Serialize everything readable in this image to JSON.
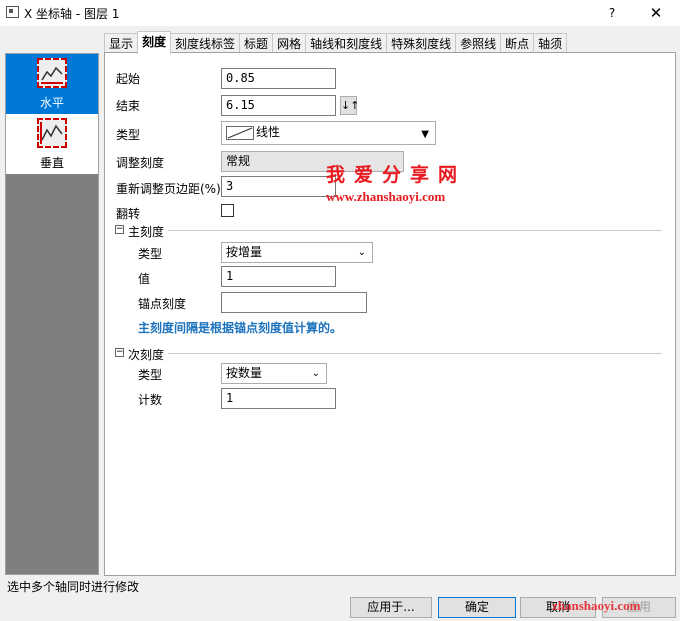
{
  "window": {
    "title": "X 坐标轴 - 图层 1",
    "help": "?",
    "close": "✕"
  },
  "tabs": [
    "显示",
    "刻度",
    "刻度线标签",
    "标题",
    "网格",
    "轴线和刻度线",
    "特殊刻度线",
    "参照线",
    "断点",
    "轴须"
  ],
  "active_tab": "刻度",
  "sidebar": {
    "items": [
      {
        "label": "水平",
        "selected": true
      },
      {
        "label": "垂直",
        "selected": false
      }
    ]
  },
  "form": {
    "start_label": "起始",
    "start_value": "0.85",
    "end_label": "结束",
    "end_value": "6.15",
    "swap_icon": "↓↑",
    "type_label": "类型",
    "type_value": "线性",
    "rescale_label": "调整刻度",
    "rescale_value": "常规",
    "margin_label": "重新调整页边距(%)",
    "margin_value": "3",
    "flip_label": "翻转"
  },
  "major": {
    "header": "主刻度",
    "type_label": "类型",
    "type_value": "按增量",
    "value_label": "值",
    "value_value": "1",
    "anchor_label": "锚点刻度",
    "anchor_value": "",
    "note": "主刻度间隔是根据锚点刻度值计算的。"
  },
  "minor": {
    "header": "次刻度",
    "type_label": "类型",
    "type_value": "按数量",
    "count_label": "计数",
    "count_value": "1"
  },
  "watermark": {
    "cn": "我爱分享网",
    "url": "www.zhanshaoyi.com",
    "corner": "zhanshaoyi.com"
  },
  "status_text": "选中多个轴同时进行修改",
  "buttons": {
    "apply_to": "应用于...",
    "ok": "确定",
    "cancel": "取消",
    "apply": "应用"
  },
  "colors": {
    "selection": "#0078d7",
    "note": "#1e73be",
    "watermark": "#e8191e"
  }
}
